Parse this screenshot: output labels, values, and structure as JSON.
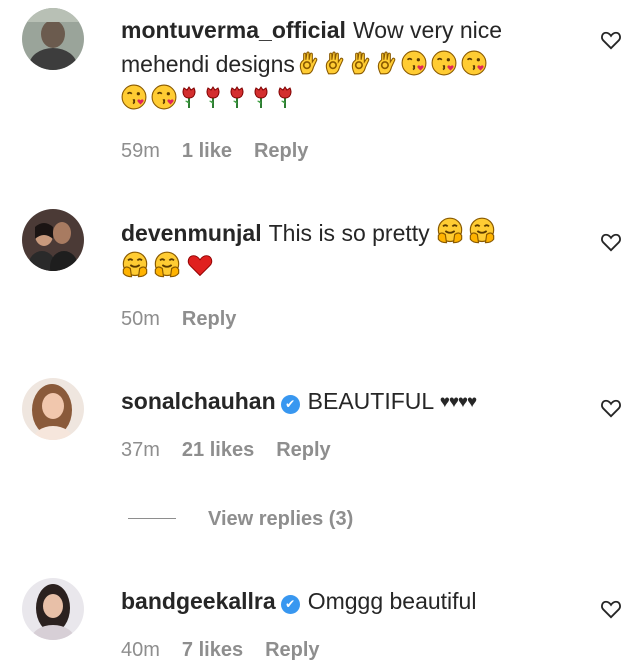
{
  "comments": [
    {
      "username": "montuverma_official",
      "verified": false,
      "text": "Wow very nice mehendi designs",
      "time": "59m",
      "likes": "1 like",
      "reply": "Reply"
    },
    {
      "username": "devenmunjal",
      "verified": false,
      "text": "This is so pretty",
      "time": "50m",
      "likes": "",
      "reply": "Reply"
    },
    {
      "username": "sonalchauhan",
      "verified": true,
      "text": "BEAUTIFUL",
      "time": "37m",
      "likes": "21 likes",
      "reply": "Reply",
      "view_replies": "View replies (3)"
    },
    {
      "username": "bandgeekallra",
      "verified": true,
      "text": "Omggg beautiful",
      "time": "40m",
      "likes": "7 likes",
      "reply": "Reply"
    }
  ],
  "colors": {
    "text": "#262626",
    "muted": "#8e8e8e",
    "verified": "#3897f0"
  },
  "icons": [
    "heart-outline-icon",
    "verified-badge-icon",
    "ok-hand-emoji",
    "kiss-emoji",
    "rose-emoji",
    "hug-emoji",
    "red-heart-emoji",
    "black-heart-emoji"
  ]
}
